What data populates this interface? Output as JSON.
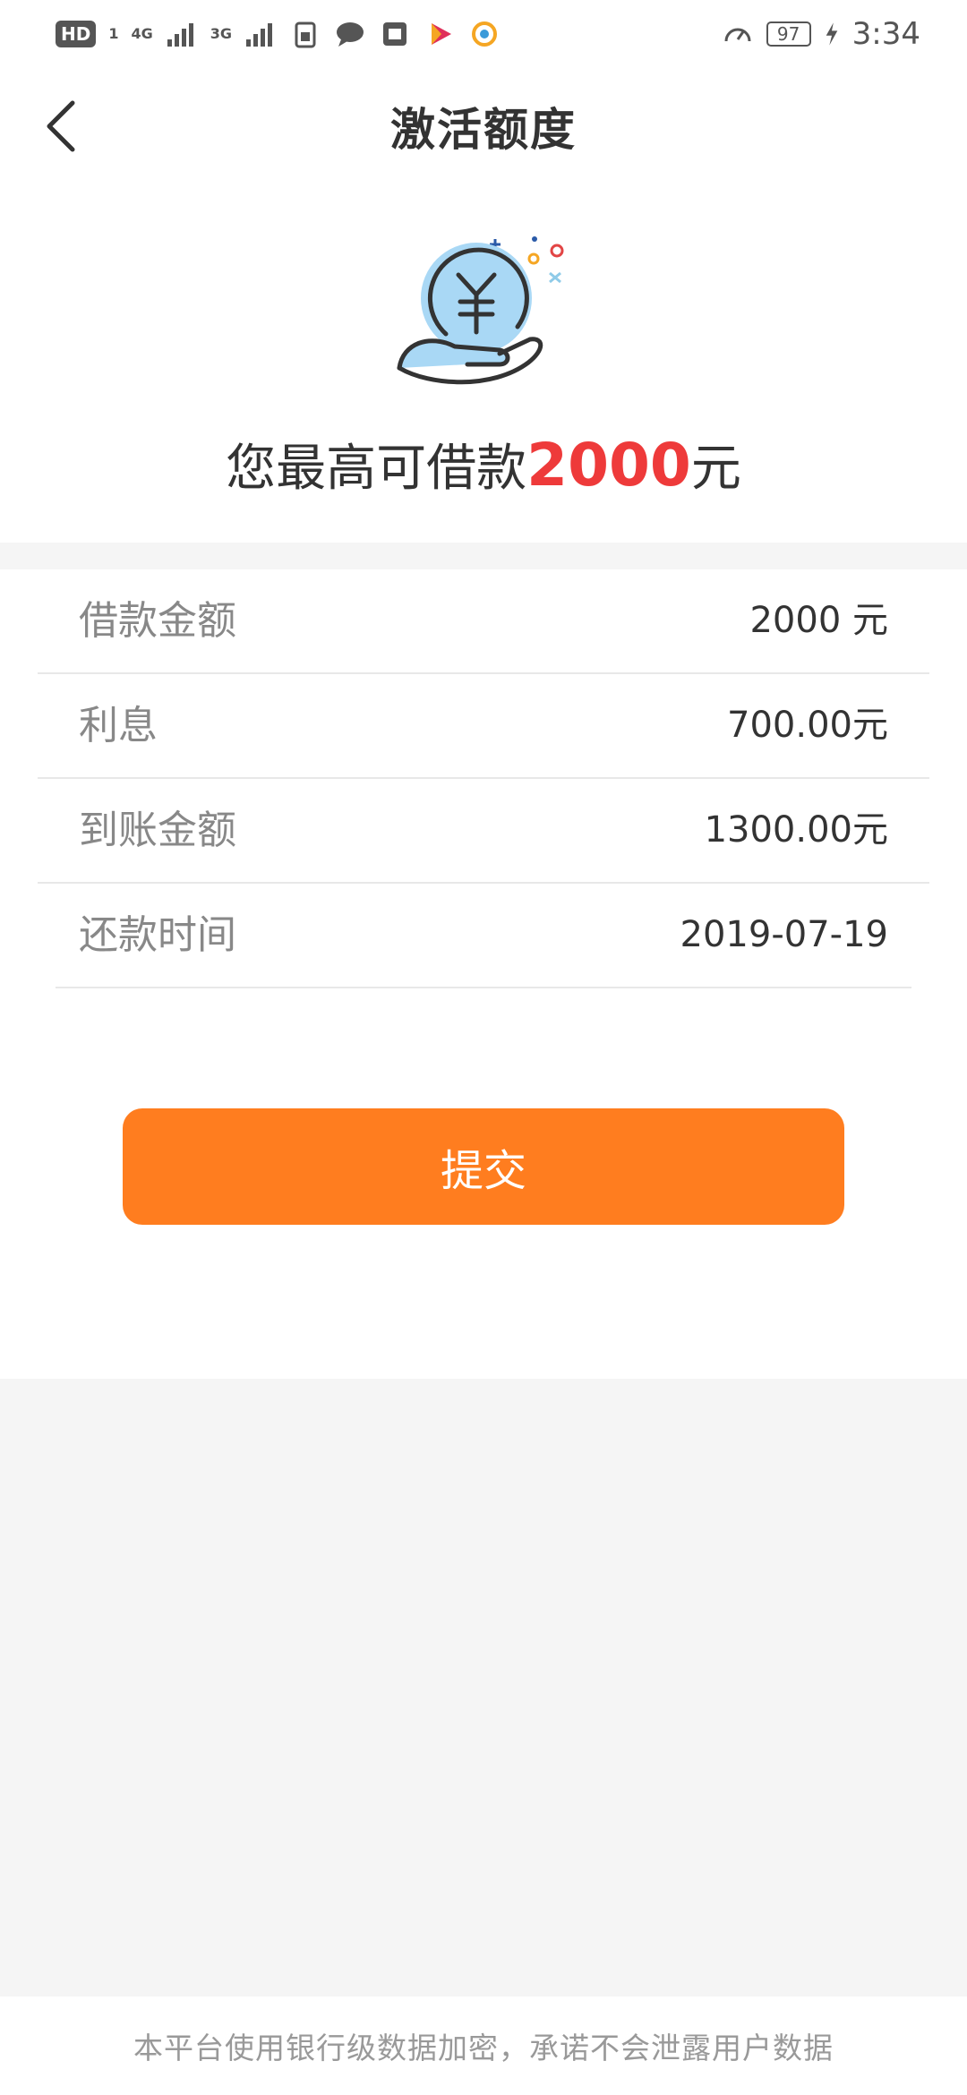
{
  "status_bar": {
    "hd_chip": "HD",
    "sim_slot": "1",
    "net1": "4G",
    "net2": "3G",
    "battery": "97",
    "time": "3:34"
  },
  "header": {
    "title": "激活额度",
    "back_icon": "chevron-left-icon"
  },
  "hero": {
    "illustration_icon": "yuan-coin-hand-icon",
    "headline_prefix": "您最高可借款",
    "headline_amount": "2000",
    "headline_suffix": "元",
    "amount_color": "#ee3a3a"
  },
  "details": [
    {
      "label": "借款金额",
      "value": "2000 元"
    },
    {
      "label": "利息",
      "value": "700.00元"
    },
    {
      "label": "到账金额",
      "value": "1300.00元"
    },
    {
      "label": "还款时间",
      "value": "2019-07-19"
    }
  ],
  "submit": {
    "label": "提交",
    "color": "#ff7d1f"
  },
  "footer": {
    "note": "本平台使用银行级数据加密，承诺不会泄露用户数据"
  }
}
